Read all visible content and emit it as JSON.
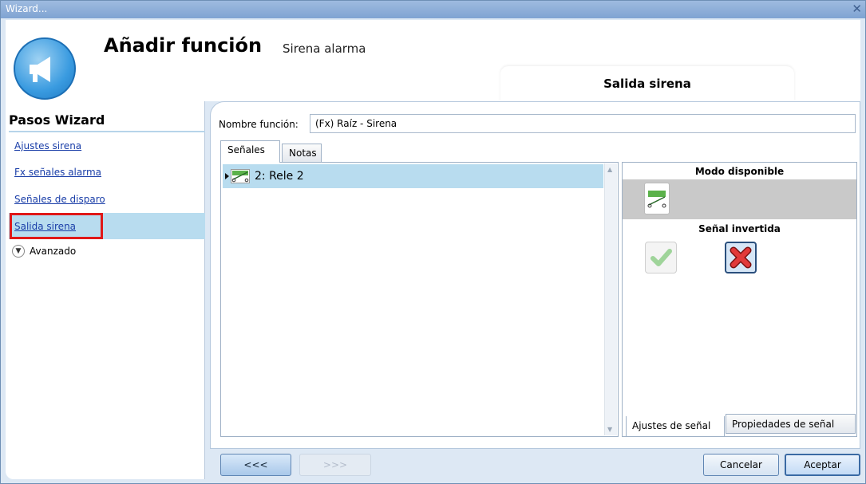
{
  "window": {
    "title": "Wizard...",
    "close": "✕"
  },
  "header": {
    "title": "Añadir función",
    "subtitle": "Sirena alarma",
    "step_tab": "Salida sirena"
  },
  "sidebar": {
    "title": "Pasos Wizard",
    "items": [
      {
        "label": "Ajustes sirena"
      },
      {
        "label": "Fx señales alarma"
      },
      {
        "label": "Señales de disparo"
      },
      {
        "label": "Salida sirena",
        "selected": true
      }
    ],
    "advanced": "Avanzado"
  },
  "form": {
    "name_label": "Nombre función:",
    "name_value": "(Fx) Raíz - Sirena"
  },
  "tabs": [
    {
      "label": "Señales",
      "active": true
    },
    {
      "label": "Notas",
      "active": false
    }
  ],
  "signals": [
    {
      "label": "2: Rele 2",
      "icon": "relay-icon"
    }
  ],
  "properties": {
    "mode_heading": "Modo disponible",
    "invert_heading": "Señal invertida",
    "tabs": [
      {
        "label": "Ajustes de señal",
        "active": true
      },
      {
        "label": "Propiedades de señal",
        "active": false
      }
    ]
  },
  "buttons": {
    "back": "<<<",
    "next": ">>>",
    "cancel": "Cancelar",
    "accept": "Aceptar"
  },
  "colors": {
    "accent": "#b8dcef",
    "highlight": "#e01818",
    "link": "#1a3ea8"
  }
}
